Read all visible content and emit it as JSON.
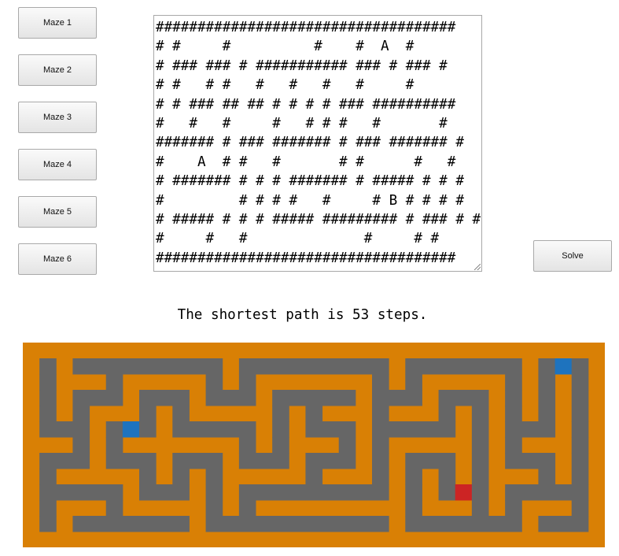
{
  "buttons": {
    "maze1": "Maze 1",
    "maze2": "Maze 2",
    "maze3": "Maze 3",
    "maze4": "Maze 4",
    "maze5": "Maze 5",
    "maze6": "Maze 6",
    "solve": "Solve"
  },
  "maze_text": "####################################\n# #     #          #    #  A  #\n# ### ### # ########### ### # ### #\n# #   # #   #   #   #   #     #\n# # ### ## ## # # # # ### ##########\n#   #   #     #   # # #   #       #\n####### # ### ####### # ### ####### #\n#    A  # #   #       # #      #   #\n# ####### # # # ####### # ##### # # #\n#         # # # #   #     # B # # # #\n# ##### # # # ##### ######### # ### # #\n#     #   #              #     # #\n####################################",
  "result_text": "The shortest path is 53 steps.",
  "colors": {
    "wall": "#d98005",
    "open": "#666666",
    "path": "#9966ff",
    "point_a": "#1e73be",
    "point_b": "#cc2424"
  },
  "maze_grid": [
    "###################################",
    "#.#.........#.........#.......#.A.#",
    "#.###.#####.#.#######.#.#####.#.#.#",
    "#.#...#...#...#.....#...#...#.#.#.#",
    "#.#.###.#.#####.#.###.###.#.#.#.#.#",
    "#...#.A.#.....#.#...#.....#.#...#.#",
    "###.#.#######.#.###.#.#####.#.###.#",
    "#...#...#...#...#...#.#...#.#...#.#",
    "#.#####.#.#.#####.###.#.#.#.###.#.#",
    "#.....#...#.#.........#.#.B.#.....#",
    "#.###.#####.#.#########.###.#.###.#",
    "#.#.......#...........#.......#...#",
    "###################################"
  ],
  "path_cells": []
}
